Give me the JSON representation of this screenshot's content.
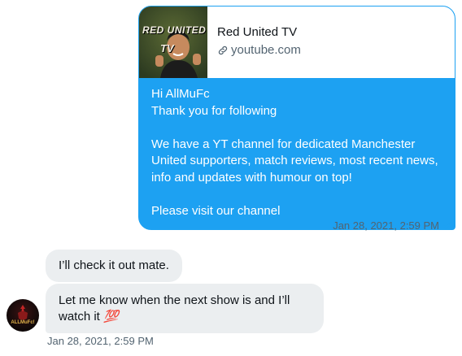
{
  "outgoing": {
    "card": {
      "thumb_text_line1": "RED UNITED",
      "thumb_text_line2": "TV",
      "title": "Red United TV",
      "domain": "youtube.com"
    },
    "text": "Hi AllMuFc\nThank you for following\n\nWe have a YT channel for dedicated Manchester United supporters, match reviews, most recent news, info and updates with humour on top!\n\nPlease visit  our  channel",
    "timestamp": "Jan 28, 2021, 2:59 PM",
    "status_icon": "check-icon",
    "bubble_color": "#1da1f2"
  },
  "incoming": {
    "messages": [
      {
        "text": "I’ll check it out mate."
      },
      {
        "text": "Let me know when the next show is and I’ll watch it",
        "emoji": "💯"
      }
    ],
    "timestamp": "Jan 28, 2021, 2:59 PM",
    "avatar_label": "ALLMuFc!",
    "bubble_color": "#ebeef0"
  }
}
